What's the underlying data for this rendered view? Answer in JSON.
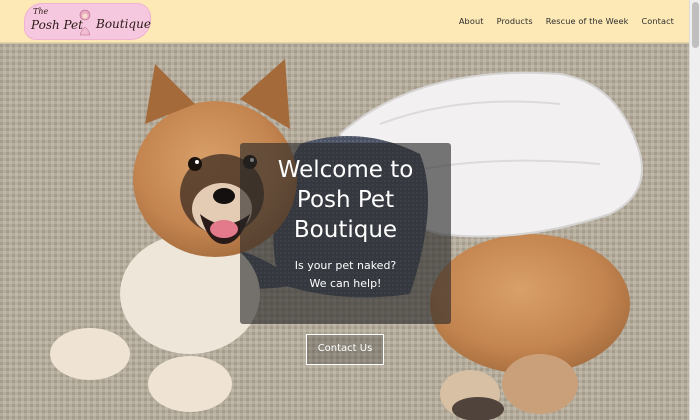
{
  "brand": {
    "logo_the": "The",
    "logo_posh": "Posh Pet",
    "logo_boutique": "Boutique"
  },
  "nav": {
    "items": [
      {
        "label": "About"
      },
      {
        "label": "Products"
      },
      {
        "label": "Rescue of the Week"
      },
      {
        "label": "Contact"
      }
    ]
  },
  "hero": {
    "title": "Welcome to Posh Pet Boutique",
    "subtitle_line1": "Is your pet naked?",
    "subtitle_line2": "We can help!",
    "cta_label": "Contact Us",
    "image_subject": "dog-wearing-dress-photo"
  },
  "colors": {
    "navbar_bg": "#fde9b5",
    "logo_bg": "#f6c8e0",
    "overlay_bg": "rgba(40,40,40,0.62)",
    "text_light": "#ffffff",
    "nav_text": "#2e2e2e"
  }
}
